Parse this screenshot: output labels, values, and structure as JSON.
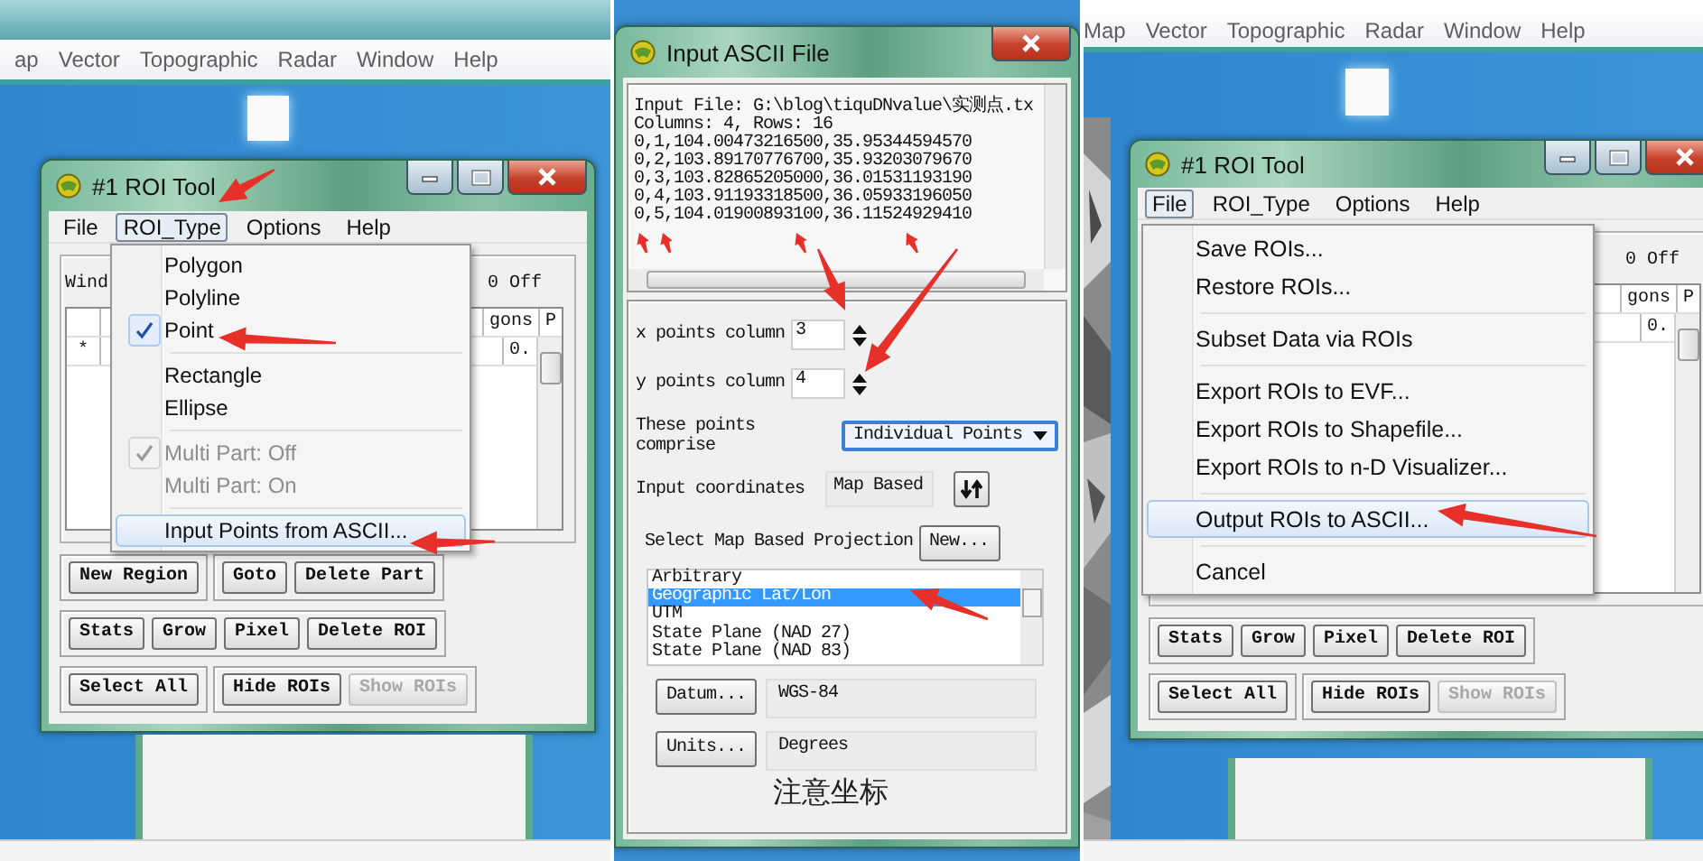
{
  "panels": [
    {
      "kind": "roi_tool",
      "app_menu": [
        "ap",
        "Vector",
        "Topographic",
        "Radar",
        "Window",
        "Help"
      ],
      "window_title": "#1 ROI Tool",
      "menu": [
        {
          "label": "File",
          "selected": false
        },
        {
          "label": "ROI_Type",
          "selected": true
        },
        {
          "label": "Options",
          "selected": false
        },
        {
          "label": "Help",
          "selected": false
        }
      ],
      "dropdown_groups": [
        [
          {
            "label": "Polygon",
            "checked": false,
            "disabled": false,
            "highlighted": false
          },
          {
            "label": "Polyline",
            "checked": false,
            "disabled": false,
            "highlighted": false
          },
          {
            "label": "Point",
            "checked": true,
            "disabled": false,
            "highlighted": false
          }
        ],
        [
          {
            "label": "Rectangle",
            "checked": false,
            "disabled": false,
            "highlighted": false
          },
          {
            "label": "Ellipse",
            "checked": false,
            "disabled": false,
            "highlighted": false
          }
        ],
        [
          {
            "label": "Multi Part: Off",
            "checked": true,
            "disabled": true,
            "highlighted": false
          },
          {
            "label": "Multi Part: On",
            "checked": false,
            "disabled": true,
            "highlighted": false
          }
        ],
        [
          {
            "label": "Input Points from ASCII...",
            "checked": false,
            "disabled": false,
            "highlighted": true
          }
        ]
      ],
      "behind": {
        "label": "Wind",
        "toggle": "0 Off",
        "column_headers": [
          "gons",
          "P"
        ],
        "row_marker": "*",
        "cell": "0."
      },
      "button_rows": [
        [
          [
            {
              "label": "New Region",
              "disabled": false
            }
          ],
          [
            {
              "label": "Goto",
              "disabled": false
            },
            {
              "label": "Delete Part",
              "disabled": false
            }
          ]
        ],
        [
          [
            {
              "label": "Stats",
              "disabled": false
            },
            {
              "label": "Grow",
              "disabled": false
            },
            {
              "label": "Pixel",
              "disabled": false
            },
            {
              "label": "Delete ROI",
              "disabled": false
            }
          ]
        ],
        [
          [
            {
              "label": "Select All",
              "disabled": false
            }
          ],
          [
            {
              "label": "Hide ROIs",
              "disabled": false
            },
            {
              "label": "Show ROIs",
              "disabled": true
            }
          ]
        ]
      ]
    },
    {
      "kind": "ascii_input",
      "window_title": "Input ASCII File",
      "file_lines": [
        "Input File: G:\\blog\\tiquDNvalue\\实测点.tx",
        "Columns: 4, Rows: 16",
        "0,1,104.00473216500,35.95344594570",
        "0,2,103.89170776700,35.93203079670",
        "0,3,103.82865205000,36.01531193190",
        "0,4,103.91193318500,36.05933196050",
        "0,5,104.01900893100,36.11524929410"
      ],
      "x_column": {
        "label": "x points column",
        "value": "3"
      },
      "y_column": {
        "label": "y points column",
        "value": "4"
      },
      "comprise": {
        "label": "These points comprise",
        "value": "Individual Points"
      },
      "coordinates": {
        "label": "Input coordinates",
        "value": "Map Based"
      },
      "projection": {
        "label": "Select Map Based Projection",
        "button": "New...",
        "items": [
          {
            "label": "Arbitrary",
            "selected": false
          },
          {
            "label": "Geographic Lat/Lon",
            "selected": true
          },
          {
            "label": "UTM",
            "selected": false
          },
          {
            "label": "State Plane (NAD 27)",
            "selected": false
          },
          {
            "label": "State Plane (NAD 83)",
            "selected": false
          }
        ]
      },
      "datum": {
        "button": "Datum...",
        "value": "WGS-84"
      },
      "units": {
        "button": "Units...",
        "value": "Degrees"
      },
      "note": "注意坐标"
    },
    {
      "kind": "roi_tool",
      "app_menu": [
        "Map",
        "Vector",
        "Topographic",
        "Radar",
        "Window",
        "Help"
      ],
      "window_title": "#1 ROI Tool",
      "menu": [
        {
          "label": "File",
          "selected": true
        },
        {
          "label": "ROI_Type",
          "selected": false
        },
        {
          "label": "Options",
          "selected": false
        },
        {
          "label": "Help",
          "selected": false
        }
      ],
      "dropdown_groups": [
        [
          {
            "label": "Save ROIs...",
            "checked": false,
            "disabled": false,
            "highlighted": false
          },
          {
            "label": "Restore ROIs...",
            "checked": false,
            "disabled": false,
            "highlighted": false
          }
        ],
        [
          {
            "label": "Subset Data via ROIs",
            "checked": false,
            "disabled": false,
            "highlighted": false
          }
        ],
        [
          {
            "label": "Export ROIs to EVF...",
            "checked": false,
            "disabled": false,
            "highlighted": false
          },
          {
            "label": "Export ROIs to Shapefile...",
            "checked": false,
            "disabled": false,
            "highlighted": false
          },
          {
            "label": "Export ROIs to n-D Visualizer...",
            "checked": false,
            "disabled": false,
            "highlighted": false
          }
        ],
        [
          {
            "label": "Output ROIs to ASCII...",
            "checked": false,
            "disabled": false,
            "highlighted": true
          }
        ],
        [
          {
            "label": "Cancel",
            "checked": false,
            "disabled": false,
            "highlighted": false
          }
        ]
      ],
      "behind": {
        "toggle": "0 Off",
        "column_headers": [
          "gons",
          "P"
        ],
        "cell": "0."
      },
      "button_rows": [
        [
          [
            {
              "label": "Stats",
              "disabled": false
            },
            {
              "label": "Grow",
              "disabled": false
            },
            {
              "label": "Pixel",
              "disabled": false
            },
            {
              "label": "Delete ROI",
              "disabled": false
            }
          ]
        ],
        [
          [
            {
              "label": "Select All",
              "disabled": false
            }
          ],
          [
            {
              "label": "Hide ROIs",
              "disabled": false
            },
            {
              "label": "Show ROIs",
              "disabled": true
            }
          ]
        ]
      ]
    }
  ]
}
